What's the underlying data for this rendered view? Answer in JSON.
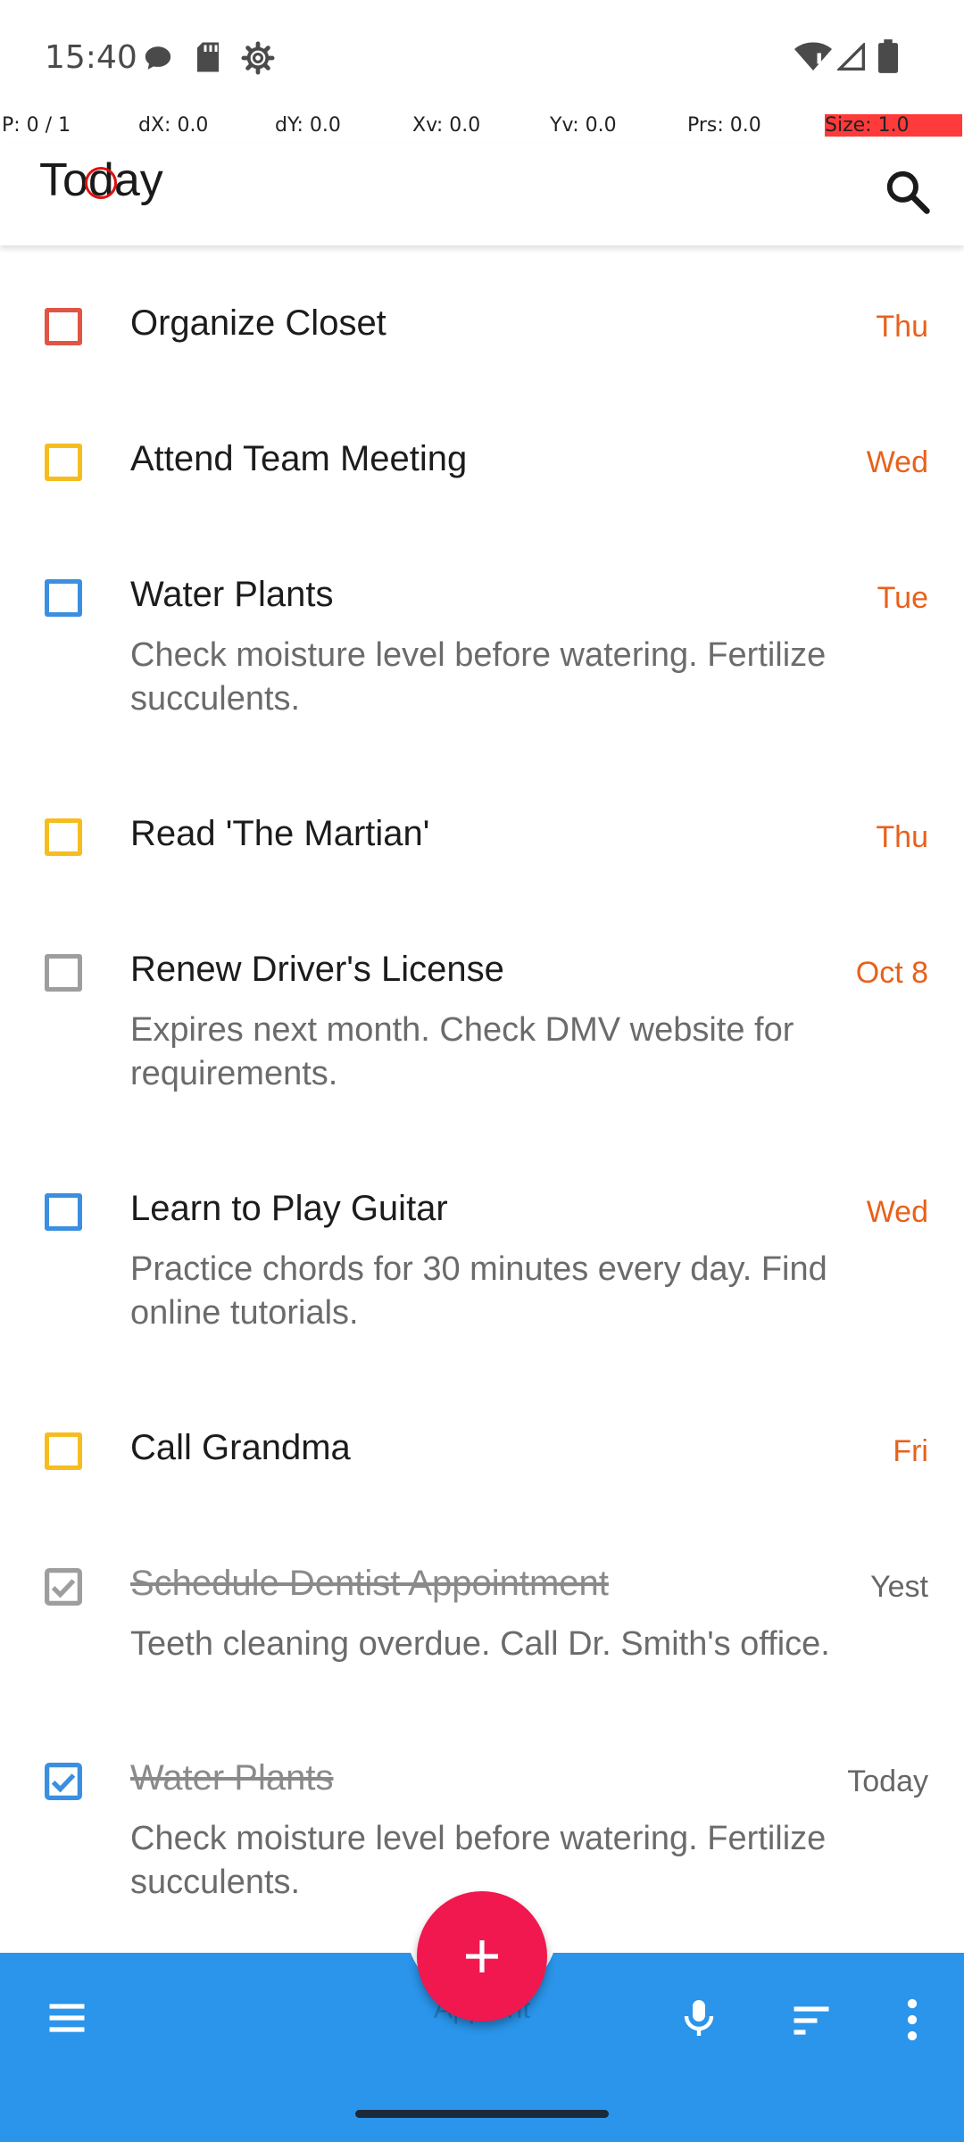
{
  "status_bar": {
    "time": "15:40",
    "icons": [
      "chat-bubble-icon",
      "sd-card-icon",
      "settings-gear-icon",
      "wifi-alert-icon",
      "cell-signal-icon",
      "battery-icon"
    ]
  },
  "debug_bar": {
    "pointer": "P: 0 / 1",
    "dx": "dX: 0.0",
    "dy": "dY: 0.0",
    "xv": "Xv: 0.0",
    "yv": "Yv: 0.0",
    "prs": "Prs: 0.0",
    "size": "Size: 1.0"
  },
  "header": {
    "title": "Today"
  },
  "colors": {
    "accent_blue": "#2a95ea",
    "fab_pink": "#f0184f",
    "due_orange": "#e8611b",
    "priority_red": "#e05545",
    "priority_yellow": "#f5bd1f",
    "priority_blue": "#3b8fe0",
    "priority_gray": "#9e9e9e"
  },
  "tasks": [
    {
      "title": "Organize Closet",
      "due": "Thu",
      "note": "",
      "priority_color": "#e05545",
      "done": false
    },
    {
      "title": "Attend Team Meeting",
      "due": "Wed",
      "note": "",
      "priority_color": "#f5bd1f",
      "done": false
    },
    {
      "title": "Water Plants",
      "due": "Tue",
      "note": "Check moisture level before watering. Fertilize succulents.",
      "priority_color": "#3b8fe0",
      "done": false
    },
    {
      "title": "Read 'The Martian'",
      "due": "Thu",
      "note": "",
      "priority_color": "#f5bd1f",
      "done": false
    },
    {
      "title": "Renew Driver's License",
      "due": "Oct 8",
      "note": "Expires next month. Check DMV website for requirements.",
      "priority_color": "#9e9e9e",
      "done": false
    },
    {
      "title": "Learn to Play Guitar",
      "due": "Wed",
      "note": "Practice chords for 30 minutes every day. Find online tutorials.",
      "priority_color": "#3b8fe0",
      "done": false
    },
    {
      "title": "Call Grandma",
      "due": "Fri",
      "note": "",
      "priority_color": "#f5bd1f",
      "done": false
    },
    {
      "title": "Schedule Dentist Appointment",
      "due": "Yest",
      "note": "Teeth cleaning overdue. Call Dr. Smith's office.",
      "priority_color": "#9e9e9e",
      "done": true
    },
    {
      "title": "Water Plants",
      "due": "Today",
      "note": "Check moisture level before watering. Fertilize succulents.",
      "priority_color": "#3b8fe0",
      "done": true
    }
  ],
  "bottom_bar": {
    "fab_label": "Add task",
    "fab_hidden_text": "Appoint",
    "icons": [
      "menu-icon",
      "microphone-icon",
      "sort-icon",
      "more-vertical-icon"
    ]
  }
}
